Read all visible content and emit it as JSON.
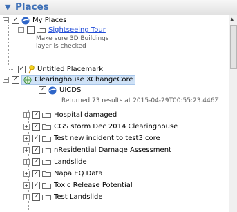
{
  "panel": {
    "title": "Places",
    "collapse_glyph": "▼"
  },
  "tree": {
    "my_places": {
      "label": "My Places",
      "expand": "−",
      "checked": true
    },
    "sightseeing": {
      "label": "Sightseeing Tour",
      "expand": "+",
      "checked": false,
      "desc_line1": "Make sure 3D Buildings",
      "desc_line2": "layer is checked"
    },
    "placemark": {
      "label": "Untitled Placemark",
      "checked": true
    },
    "clearinghouse": {
      "label": "Clearinghouse XChangeCore",
      "expand": "−",
      "checked": true
    },
    "uicds": {
      "label": "UICDS",
      "checked": true
    },
    "result_text": "Returned 73 results at 2015-04-29T00:55:23.446Z",
    "folders": [
      {
        "label": "Hospital damaged",
        "expand": "+",
        "checked": true
      },
      {
        "label": "CGS storm Dec 2014 Clearinghouse",
        "expand": "+",
        "checked": true
      },
      {
        "label": "Test new incident to test3 core",
        "expand": "+",
        "checked": true
      },
      {
        "label": "nResidential Damage Assessment",
        "expand": "+",
        "checked": true
      },
      {
        "label": "Landslide",
        "expand": "+",
        "checked": true
      },
      {
        "label": "Napa EQ Data",
        "expand": "+",
        "checked": true
      },
      {
        "label": "Toxic Release Potential",
        "expand": "+",
        "checked": true
      },
      {
        "label": "Test Landslide",
        "expand": "+",
        "checked": true
      }
    ],
    "check_glyph": "✓"
  },
  "scrollbar": {
    "up_glyph": "▲"
  },
  "colors": {
    "accent": "#3d6fb6",
    "link": "#1f4bd8",
    "selection": "#cfe2f7",
    "folder": "#f0cf62"
  }
}
